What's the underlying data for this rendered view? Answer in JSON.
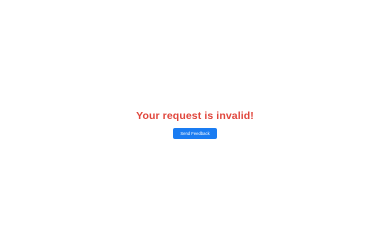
{
  "error": {
    "message": "Your request is invalid!",
    "button_label": "Send Feedback"
  },
  "colors": {
    "background": "#ffffff",
    "error_text": "#e0463c",
    "button_bg": "#1a7cf2",
    "button_text": "#ffffff"
  }
}
